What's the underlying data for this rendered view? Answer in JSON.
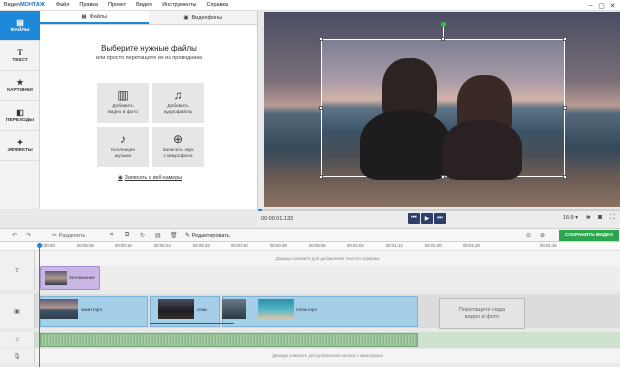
{
  "app": {
    "brand_a": "Видео",
    "brand_b": "МОНТАЖ"
  },
  "menu": [
    "Файл",
    "Правка",
    "Проект",
    "Видео",
    "Инструменты",
    "Справка"
  ],
  "nav": [
    {
      "label": "ФАЙЛЫ",
      "icon": "folder-icon",
      "active": true
    },
    {
      "label": "ТЕКСТ",
      "icon": "text-icon"
    },
    {
      "label": "КАРТИНКИ",
      "icon": "star-icon"
    },
    {
      "label": "ПЕРЕХОДЫ",
      "icon": "transitions-icon"
    },
    {
      "label": "ЭФФЕКТЫ",
      "icon": "wand-icon"
    }
  ],
  "tabs": {
    "files": "Файлы",
    "backgrounds": "Видеофоны"
  },
  "panel": {
    "title": "Выберите нужные файлы",
    "subtitle": "или просто перетащите их из проводника"
  },
  "tiles": [
    {
      "label1": "Добавить",
      "label2": "видео и фото",
      "icon": "film-add-icon"
    },
    {
      "label1": "Добавить",
      "label2": "аудиофайлы",
      "icon": "audio-add-icon"
    },
    {
      "label1": "Коллекция",
      "label2": "музыки",
      "icon": "music-icon"
    },
    {
      "label1": "Записать звук",
      "label2": "с микрофона",
      "icon": "mic-icon"
    }
  ],
  "webcam": "Записать с веб-камеры",
  "player": {
    "time": "00:00:01.133",
    "ratio": "16:9"
  },
  "toolbar": {
    "split": "Разделить",
    "edit": "Редактировать",
    "save": "СОХРАНИТЬ ВИДЕО"
  },
  "ruler": [
    "00:00:00",
    "00:00:08",
    "00:00:16",
    "00:00:24",
    "00:00:32",
    "00:00:40",
    "00:00:48",
    "00:00:56",
    "00:01:04",
    "00:01:12",
    "00:01:20",
    "00:01:28",
    "00:01:36"
  ],
  "tracks": {
    "text_hint": "Дважды кликните для добавления текста и графики",
    "fx_clip": "Затемнение",
    "clips": [
      "закат.mp4",
      "семь",
      "пляж.mp4"
    ],
    "dropzone_1": "Перетащите сюда",
    "dropzone_2": "видео и фото",
    "mic_hint": "Дважды кликните для добавления записи с микрофона"
  },
  "colors": {
    "accent": "#1e88d8",
    "save": "#2da44e",
    "transport": "#2c3e6a"
  }
}
